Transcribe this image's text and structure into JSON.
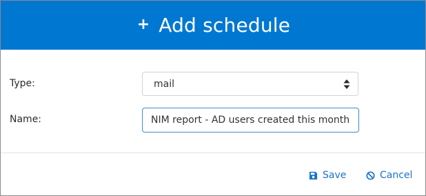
{
  "dialog": {
    "title": "Add schedule",
    "header_icon": "plus-icon",
    "header_color": "#0078d2"
  },
  "form": {
    "type": {
      "label": "Type:",
      "value": "mail",
      "icon": "sort-arrows-icon"
    },
    "name": {
      "label": "Name:",
      "value": "NIM report - AD users created this month"
    }
  },
  "actions": {
    "save": {
      "label": "Save",
      "icon": "floppy-disk-icon"
    },
    "cancel": {
      "label": "Cancel",
      "icon": "ban-icon"
    },
    "link_color": "#1a73c8"
  }
}
